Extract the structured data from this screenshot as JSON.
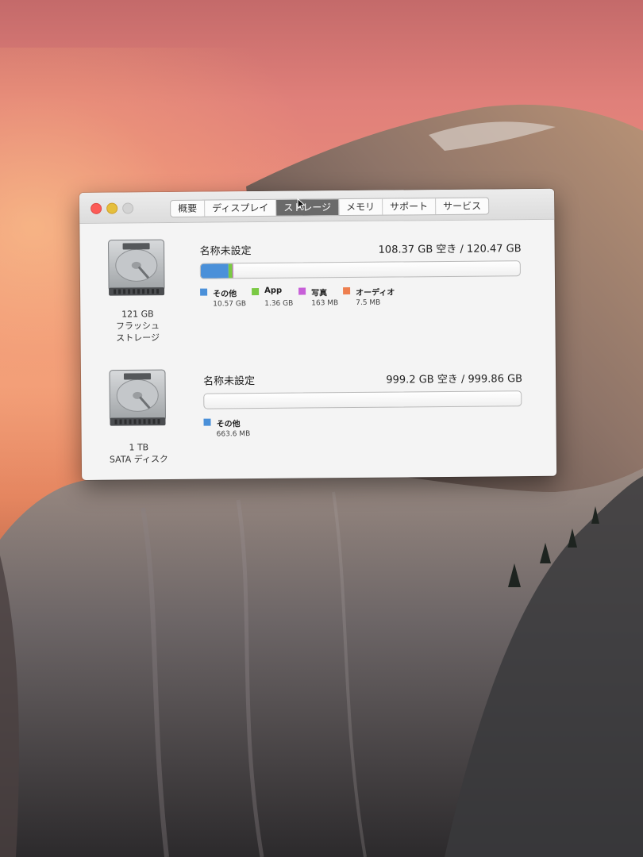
{
  "window": {
    "tabs": [
      {
        "label": "概要",
        "active": false
      },
      {
        "label": "ディスプレイ",
        "active": false
      },
      {
        "label": "ストレージ",
        "active": true
      },
      {
        "label": "メモリ",
        "active": false
      },
      {
        "label": "サポート",
        "active": false
      },
      {
        "label": "サービス",
        "active": false
      }
    ]
  },
  "drives": [
    {
      "caption": [
        "121 GB",
        "フラッシュ",
        "ストレージ"
      ],
      "volume_name": "名称未設定",
      "free_text": "108.37 GB 空き / 120.47 GB",
      "capacity_gb": 120.47,
      "categories": [
        {
          "label": "その他",
          "size": "10.57 GB",
          "size_gb": 10.57,
          "color": "#4a90d9"
        },
        {
          "label": "App",
          "size": "1.36 GB",
          "size_gb": 1.36,
          "color": "#7ac943"
        },
        {
          "label": "写真",
          "size": "163 MB",
          "size_gb": 0.163,
          "color": "#c75fd8"
        },
        {
          "label": "オーディオ",
          "size": "7.5 MB",
          "size_gb": 0.0075,
          "color": "#ee7f4f"
        }
      ]
    },
    {
      "caption": [
        "1 TB",
        "SATA ディスク"
      ],
      "volume_name": "名称未設定",
      "free_text": "999.2 GB 空き / 999.86 GB",
      "capacity_gb": 999.86,
      "categories": [
        {
          "label": "その他",
          "size": "663.6 MB",
          "size_gb": 0.6636,
          "color": "#4a90d9"
        }
      ]
    }
  ]
}
